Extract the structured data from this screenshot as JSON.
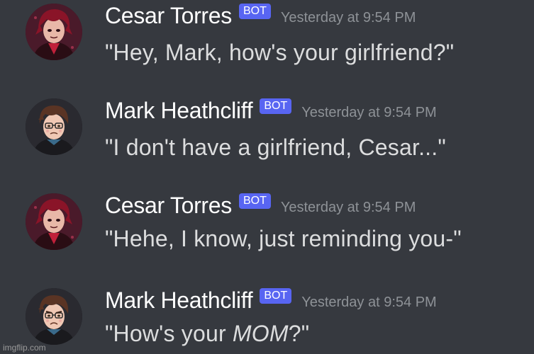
{
  "messages": [
    {
      "username": "Cesar Torres",
      "bot_tag": "BOT",
      "timestamp": "Yesterday at 9:54 PM",
      "text": "\"Hey, Mark, how's your girlfriend?\"",
      "avatar_icon": "red-haired-character-avatar"
    },
    {
      "username": "Mark Heathcliff",
      "bot_tag": "BOT",
      "timestamp": "Yesterday at 9:54 PM",
      "text": "\"I don't have a girlfriend, Cesar...\"",
      "avatar_icon": "brown-haired-glasses-character-avatar"
    },
    {
      "username": "Cesar Torres",
      "bot_tag": "BOT",
      "timestamp": "Yesterday at 9:54 PM",
      "text": "\"Hehe, I know, just reminding you-\"",
      "avatar_icon": "red-haired-character-avatar"
    },
    {
      "username": "Mark Heathcliff",
      "bot_tag": "BOT",
      "timestamp": "Yesterday at 9:54 PM",
      "text_before": "\"How's your ",
      "text_emphasis": "MOM",
      "text_after": "?\"",
      "avatar_icon": "brown-haired-glasses-character-avatar"
    }
  ],
  "watermark": "imgflip.com",
  "colors": {
    "background": "#36393f",
    "username": "#ffffff",
    "message_text": "#dcddde",
    "timestamp": "#8e9297",
    "bot_tag_bg": "#5865f2"
  }
}
